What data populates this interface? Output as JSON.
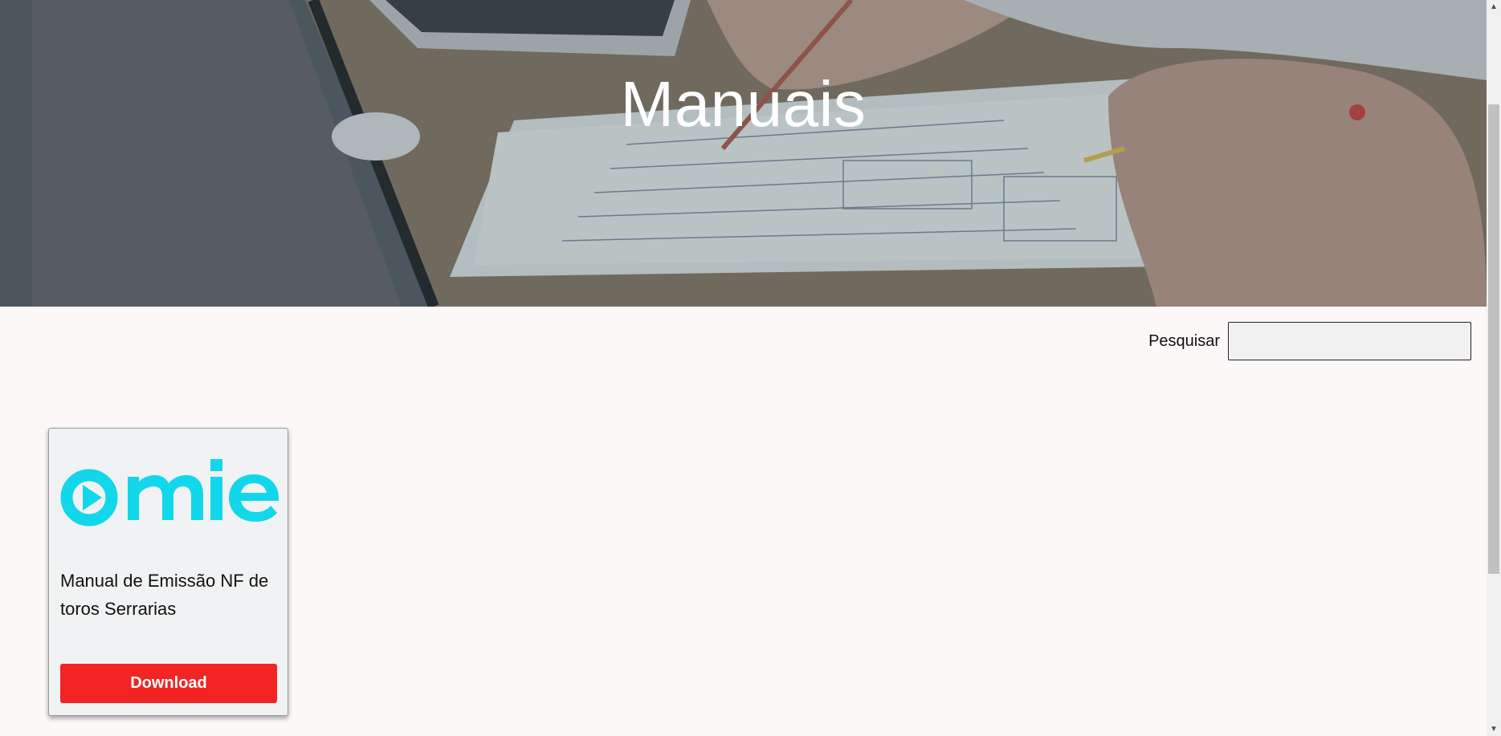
{
  "hero": {
    "title": "Manuais"
  },
  "search": {
    "label": "Pesquisar",
    "value": "",
    "placeholder": ""
  },
  "manuals": [
    {
      "logo_text": "omie",
      "logo_color": "#12d7ea",
      "title": "Manual de Emissão NF de toros Serrarias",
      "button_label": "Download",
      "button_color": "#f32424"
    }
  ],
  "icons": {
    "scroll_up": "chevron-up-icon",
    "scroll_down": "chevron-down-icon"
  }
}
